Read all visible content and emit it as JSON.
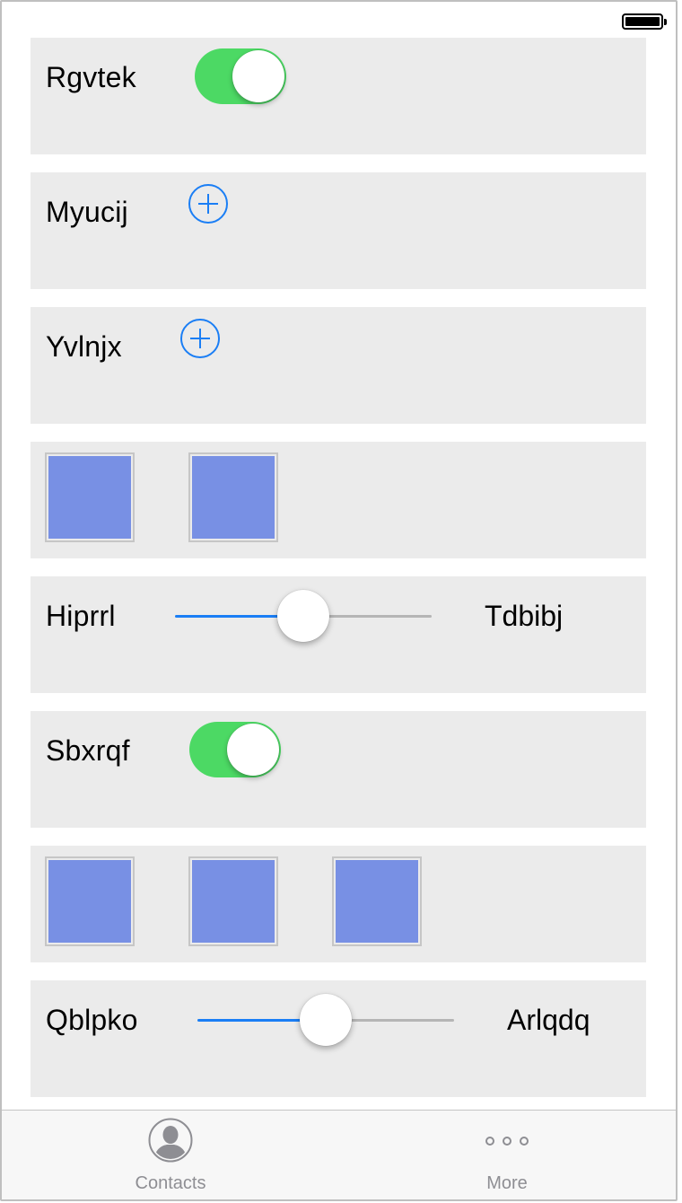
{
  "rows": {
    "toggle_row_1": {
      "label": "Rgvtek",
      "toggle_on": true
    },
    "add_row_1": {
      "label": "Myucij"
    },
    "add_row_2": {
      "label": "Yvlnjx"
    },
    "swatch_row_1": {
      "swatch_count": 2
    },
    "slider_row_1": {
      "min_label": "Hiprrl",
      "max_label": "Tdbibj",
      "value_fraction": 0.5
    },
    "toggle_row_2": {
      "label": "Sbxrqf",
      "toggle_on": true
    },
    "swatch_row_2": {
      "swatch_count": 3
    },
    "slider_row_2": {
      "min_label": "Qblpko",
      "max_label": "Arlqdq",
      "value_fraction": 0.5
    }
  },
  "tab_bar": {
    "tabs": [
      {
        "label": "Contacts",
        "icon": "person-circle-icon"
      },
      {
        "label": "More",
        "icon": "more-icon"
      }
    ]
  },
  "colors": {
    "row_background": "#ebebeb",
    "toggle_on": "#4cd964",
    "accent_blue": "#1a7ef5",
    "swatch_fill": "#7890e4",
    "tab_inactive": "#8e8e93"
  }
}
